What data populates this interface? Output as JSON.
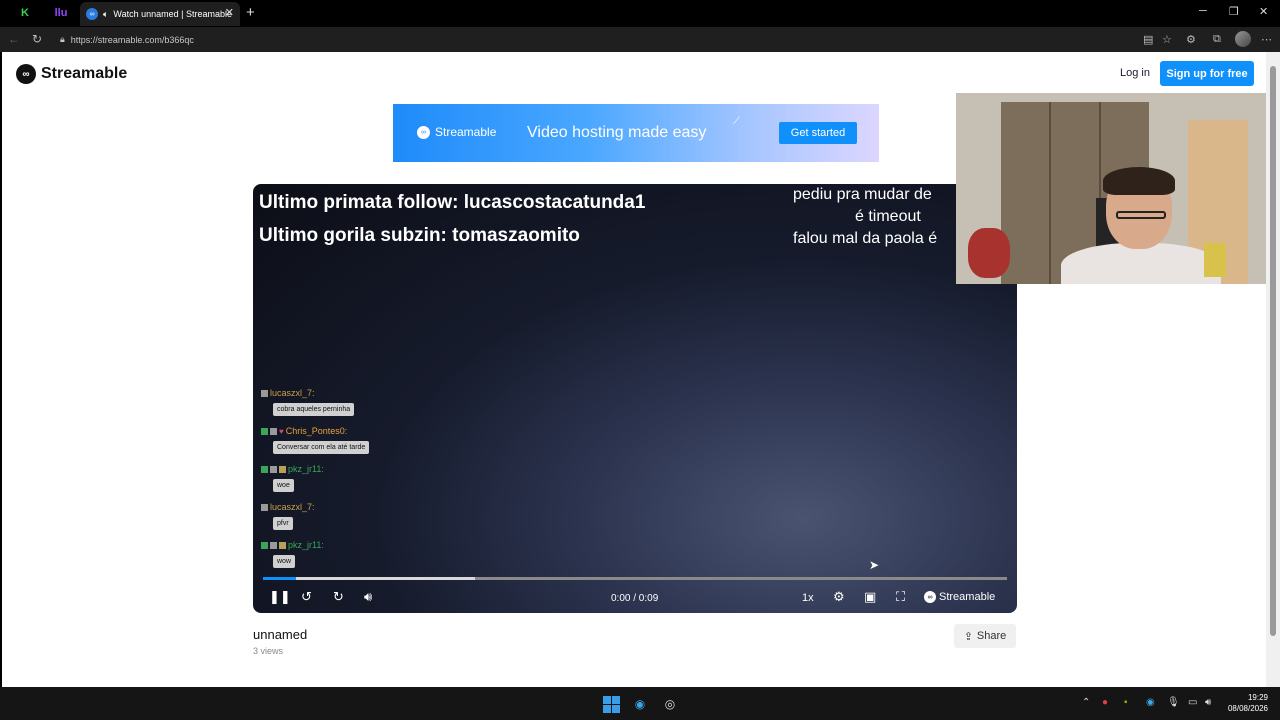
{
  "browser": {
    "tab_title": "Watch unnamed | Streamable",
    "tab_close": "✕",
    "new_tab": "+",
    "url": "https://streamable.com/b366qc",
    "pinned_tab_1": "K",
    "pinned_tab_2": "llu"
  },
  "header": {
    "logo_text": "Streamable",
    "login": "Log in",
    "signup": "Sign up for free"
  },
  "banner": {
    "logo_text": "Streamable",
    "tagline": "Video hosting made easy",
    "cta": "Get started"
  },
  "video": {
    "overlay_line1": "Ultimo primata follow: lucascostacatunda1",
    "overlay_line2": "Ultimo gorila subzin: tomaszaomito",
    "overlay_right1": "pediu pra mudar de",
    "overlay_right2": "é timeout",
    "overlay_right3": "falou mal da paola é",
    "chat": [
      {
        "user": "lucaszxl_7:",
        "message": "cobra aqueles perninha",
        "color": "#c9a24a"
      },
      {
        "user": "Chris_Pontes0:",
        "message": "Conversar com ela até tarde",
        "color": "#e6a23c"
      },
      {
        "user": "pkz_jr11:",
        "message": "woe",
        "color": "#3aa65a"
      },
      {
        "user": "lucaszxl_7:",
        "message": "pfvr",
        "color": "#c9a24a"
      },
      {
        "user": "pkz_jr11:",
        "message": "wow",
        "color": "#3aa65a"
      }
    ],
    "time": "0:00 / 0:09",
    "played_fraction": 0.045,
    "buffered_fraction": 0.285,
    "speed": "1x",
    "watermark": "Streamable",
    "title": "unnamed",
    "views": "3 views",
    "share": "Share"
  },
  "taskbar": {
    "time": "19:29",
    "date": "08/08/2026"
  },
  "colors": {
    "accent": "#0f90fa"
  }
}
